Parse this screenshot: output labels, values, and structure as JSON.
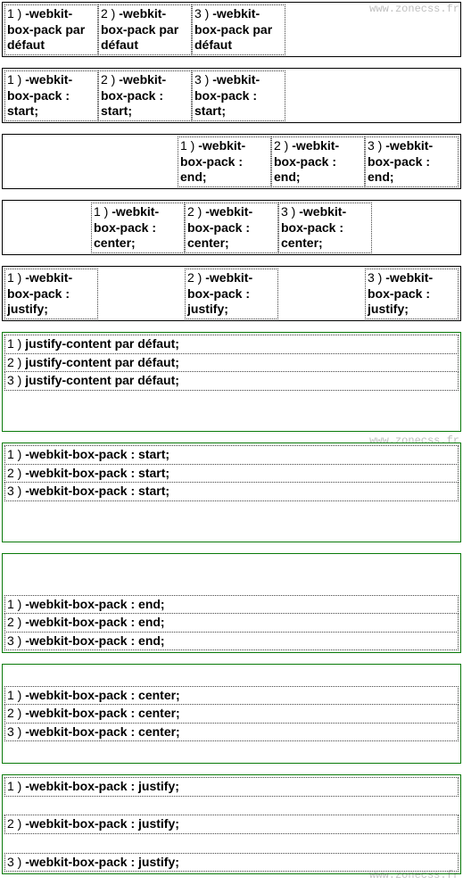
{
  "watermark": "www.zonecss.fr",
  "h": {
    "default": {
      "c1": {
        "n": "1 )",
        "p": "-webkit-box-pack",
        "v": " par défaut"
      },
      "c2": {
        "n": "2 )",
        "p": "-webkit-box-pack",
        "v": " par défaut"
      },
      "c3": {
        "n": "3 )",
        "p": "-webkit-box-pack",
        "v": " par défaut"
      }
    },
    "start": {
      "c1": {
        "n": "1 )",
        "p": "-webkit-box-pack :",
        "v": "start;"
      },
      "c2": {
        "n": "2 )",
        "p": "-webkit-box-pack :",
        "v": "start;"
      },
      "c3": {
        "n": "3 )",
        "p": "-webkit-box-pack :",
        "v": "start;"
      }
    },
    "end": {
      "c1": {
        "n": "1 )",
        "p": "-webkit-box-pack :",
        "v": "end;"
      },
      "c2": {
        "n": "2 )",
        "p": "-webkit-box-pack :",
        "v": "end;"
      },
      "c3": {
        "n": "3 )",
        "p": "-webkit-box-pack :",
        "v": "end;"
      }
    },
    "center": {
      "c1": {
        "n": "1 )",
        "p": "-webkit-box-pack :",
        "v": "center;"
      },
      "c2": {
        "n": "2 )",
        "p": "-webkit-box-pack :",
        "v": "center;"
      },
      "c3": {
        "n": "3 )",
        "p": "-webkit-box-pack :",
        "v": "center;"
      }
    },
    "justify": {
      "c1": {
        "n": "1 )",
        "p": "-webkit-box-pack :",
        "v": "justify;"
      },
      "c2": {
        "n": "2 )",
        "p": "-webkit-box-pack :",
        "v": "justify;"
      },
      "c3": {
        "n": "3 )",
        "p": "-webkit-box-pack :",
        "v": "justify;"
      }
    }
  },
  "v": {
    "default": {
      "r1": {
        "n": "1 )",
        "p": "justify-content",
        "v": " par défaut;"
      },
      "r2": {
        "n": "2 )",
        "p": "justify-content",
        "v": " par défaut;"
      },
      "r3": {
        "n": "3 )",
        "p": "justify-content",
        "v": " par défaut;"
      }
    },
    "start": {
      "r1": {
        "n": "1 )",
        "p": "-webkit-box-pack : start;"
      },
      "r2": {
        "n": "2 )",
        "p": "-webkit-box-pack : start;"
      },
      "r3": {
        "n": "3 )",
        "p": "-webkit-box-pack : start;"
      }
    },
    "end": {
      "r1": {
        "n": "1 )",
        "p": "-webkit-box-pack : end;"
      },
      "r2": {
        "n": "2 )",
        "p": "-webkit-box-pack : end;"
      },
      "r3": {
        "n": "3 )",
        "p": "-webkit-box-pack : end;"
      }
    },
    "center": {
      "r1": {
        "n": "1 )",
        "p": "-webkit-box-pack : center;"
      },
      "r2": {
        "n": "2 )",
        "p": "-webkit-box-pack : center;"
      },
      "r3": {
        "n": "3 )",
        "p": "-webkit-box-pack : center;"
      }
    },
    "justify": {
      "r1": {
        "n": "1 )",
        "p": "-webkit-box-pack : justify;"
      },
      "r2": {
        "n": "2 )",
        "p": "-webkit-box-pack : justify;"
      },
      "r3": {
        "n": "3 )",
        "p": "-webkit-box-pack : justify;"
      }
    }
  }
}
